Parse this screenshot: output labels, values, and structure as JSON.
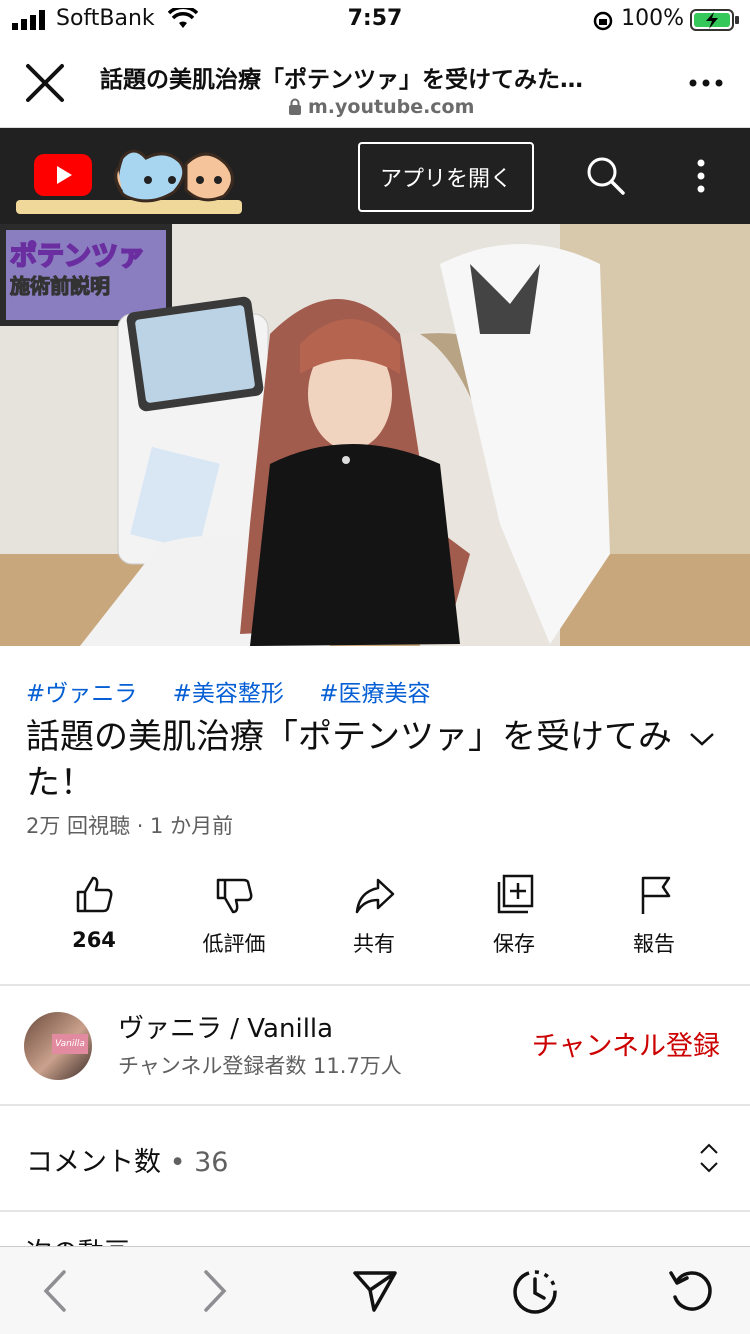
{
  "status_bar": {
    "carrier": "SoftBank",
    "time": "7:57",
    "battery": "100%"
  },
  "browser": {
    "page_title": "話題の美肌治療「ポテンツァ」を受けてみた…",
    "url": "m.youtube.com"
  },
  "ytbar": {
    "open_app_label": "アプリを開く"
  },
  "video": {
    "overlay_title": "ポテンツァ",
    "overlay_sub": "施術前説明"
  },
  "hashtags": [
    "#ヴァニラ",
    "#美容整形",
    "#医療美容"
  ],
  "video_title": "話題の美肌治療「ポテンツァ」を受けてみた！",
  "meta": "2万 回視聴 · 1 か月前",
  "actions": {
    "like": "264",
    "dislike": "低評価",
    "share": "共有",
    "save": "保存",
    "report": "報告"
  },
  "channel": {
    "name": "ヴァニラ / Vanilla",
    "subscribers": "チャンネル登録者数 11.7万人",
    "subscribe_label": "チャンネル登録",
    "avatar_text": "Vanilla"
  },
  "comments": {
    "label": "コメント数",
    "separator": " • ",
    "count": "36"
  },
  "next_label": "次の動画",
  "colors": {
    "accent_red": "#cc0000",
    "link_blue": "#065fd4",
    "yt_bar": "#212121"
  }
}
